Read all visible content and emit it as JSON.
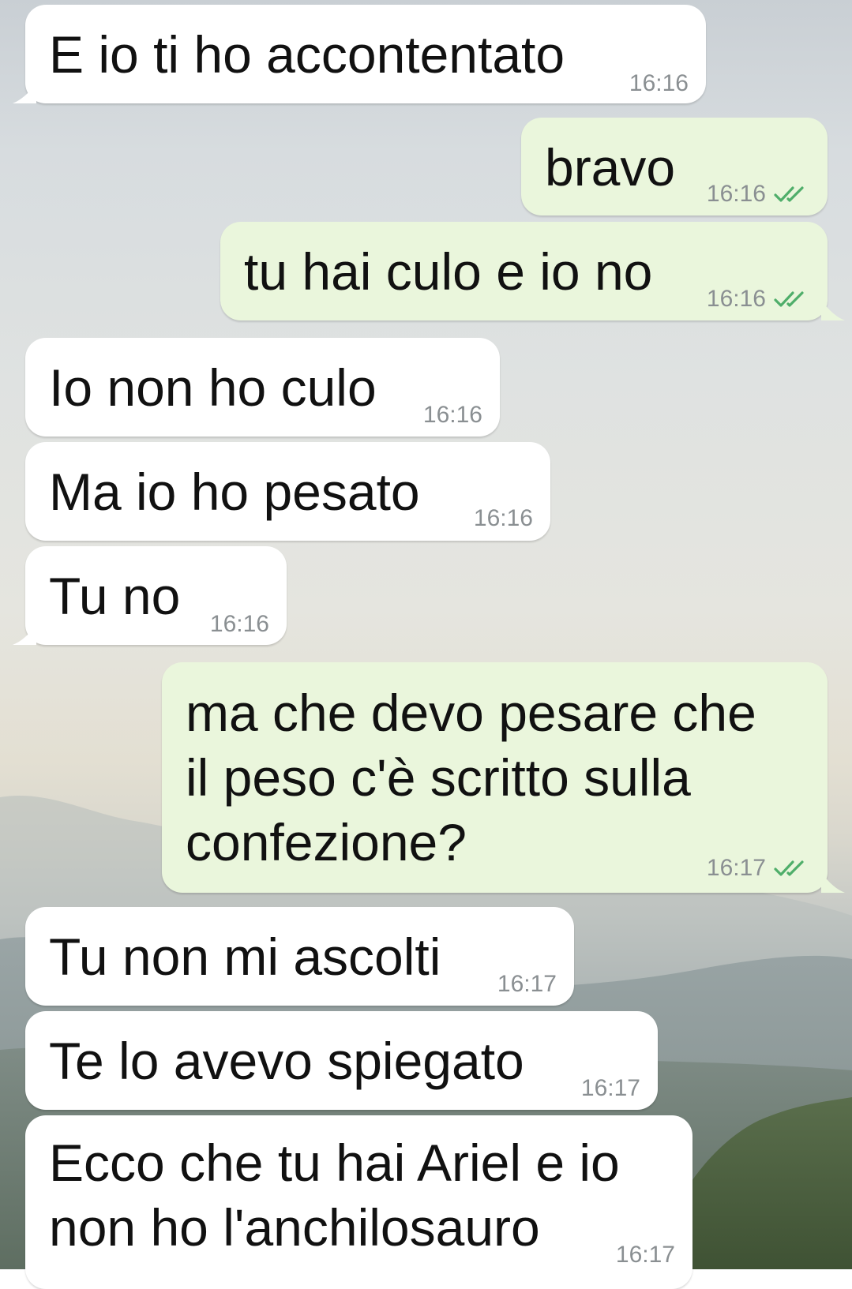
{
  "colors": {
    "incoming_bubble": "#ffffff",
    "outgoing_bubble": "#eaf6dc",
    "timestamp": "#8a8f92",
    "read_ticks": "#4fae6a"
  },
  "messages": [
    {
      "direction": "in",
      "text": "E io ti ho accontentato",
      "time": "16:16"
    },
    {
      "direction": "out",
      "text": "bravo",
      "time": "16:16",
      "status_icon": "double-check-icon"
    },
    {
      "direction": "out",
      "text": "tu hai culo e io no",
      "time": "16:16",
      "status_icon": "double-check-icon"
    },
    {
      "direction": "in",
      "text": "Io non ho culo",
      "time": "16:16"
    },
    {
      "direction": "in",
      "text": "Ma io ho pesato",
      "time": "16:16"
    },
    {
      "direction": "in",
      "text": "Tu no",
      "time": "16:16"
    },
    {
      "direction": "out",
      "lines": [
        "ma che devo pesare che",
        "il peso c'è scritto sulla",
        "confezione?"
      ],
      "time": "16:17",
      "status_icon": "double-check-icon"
    },
    {
      "direction": "in",
      "text": "Tu non mi ascolti",
      "time": "16:17"
    },
    {
      "direction": "in",
      "text": "Te lo avevo spiegato",
      "time": "16:17"
    },
    {
      "direction": "in",
      "lines": [
        "Ecco che tu hai Ariel e io",
        "non ho l'anchilosauro"
      ],
      "time": "16:17"
    }
  ]
}
